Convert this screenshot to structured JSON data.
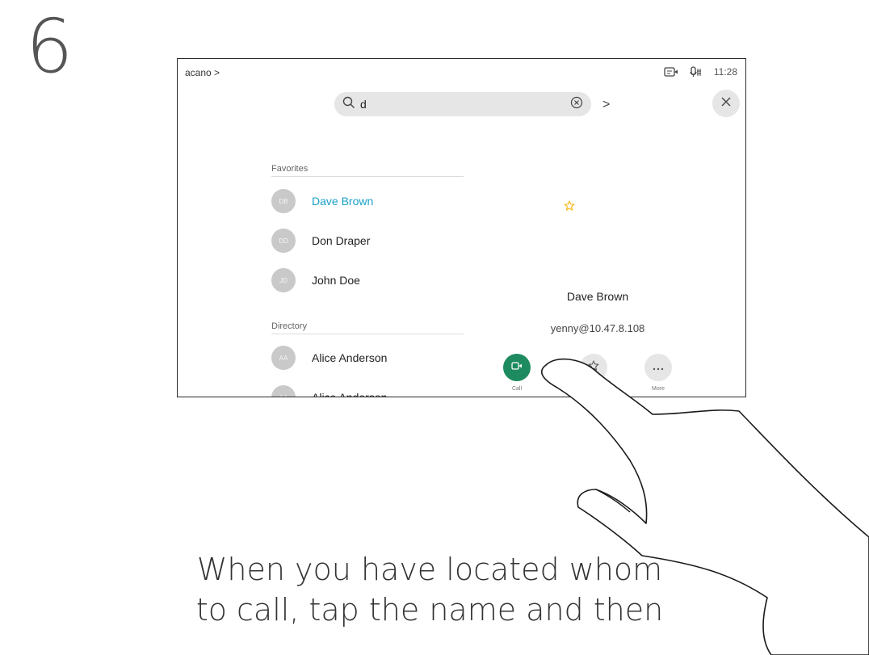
{
  "step_number": "6",
  "device": {
    "breadcrumb": "acano >",
    "status": {
      "clock": "11:28",
      "icons": [
        "self-view-icon",
        "mic-icon"
      ]
    },
    "search": {
      "value": "d",
      "clear_icon": "clear-icon",
      "arrow": ">"
    },
    "close_icon": "close-icon",
    "favorites": {
      "label": "Favorites",
      "items": [
        {
          "initials": "DB",
          "name": "Dave Brown",
          "selected": true
        },
        {
          "initials": "DD",
          "name": "Don Draper",
          "selected": false
        },
        {
          "initials": "JD",
          "name": "John Doe",
          "selected": false
        }
      ]
    },
    "directory": {
      "label": "Directory",
      "items": [
        {
          "initials": "AA",
          "name": "Alice Anderson"
        },
        {
          "initials": "AA",
          "name": "Alice Anderson"
        }
      ]
    },
    "detail": {
      "name": "Dave Brown",
      "address": "yenny@10.47.8.108",
      "favorite_color": "#f5b400",
      "actions": [
        {
          "label": "Call",
          "icon": "video-icon",
          "color": "#1e8a5f"
        },
        {
          "label": "",
          "icon": "star-icon",
          "color": "#e6e6e6"
        },
        {
          "label": "More",
          "icon": "more-icon",
          "color": "#e6e6e6"
        }
      ]
    },
    "accent_color": "#1aa0c8"
  },
  "caption": [
    "When you have located whom",
    "to call, tap the name and then"
  ]
}
